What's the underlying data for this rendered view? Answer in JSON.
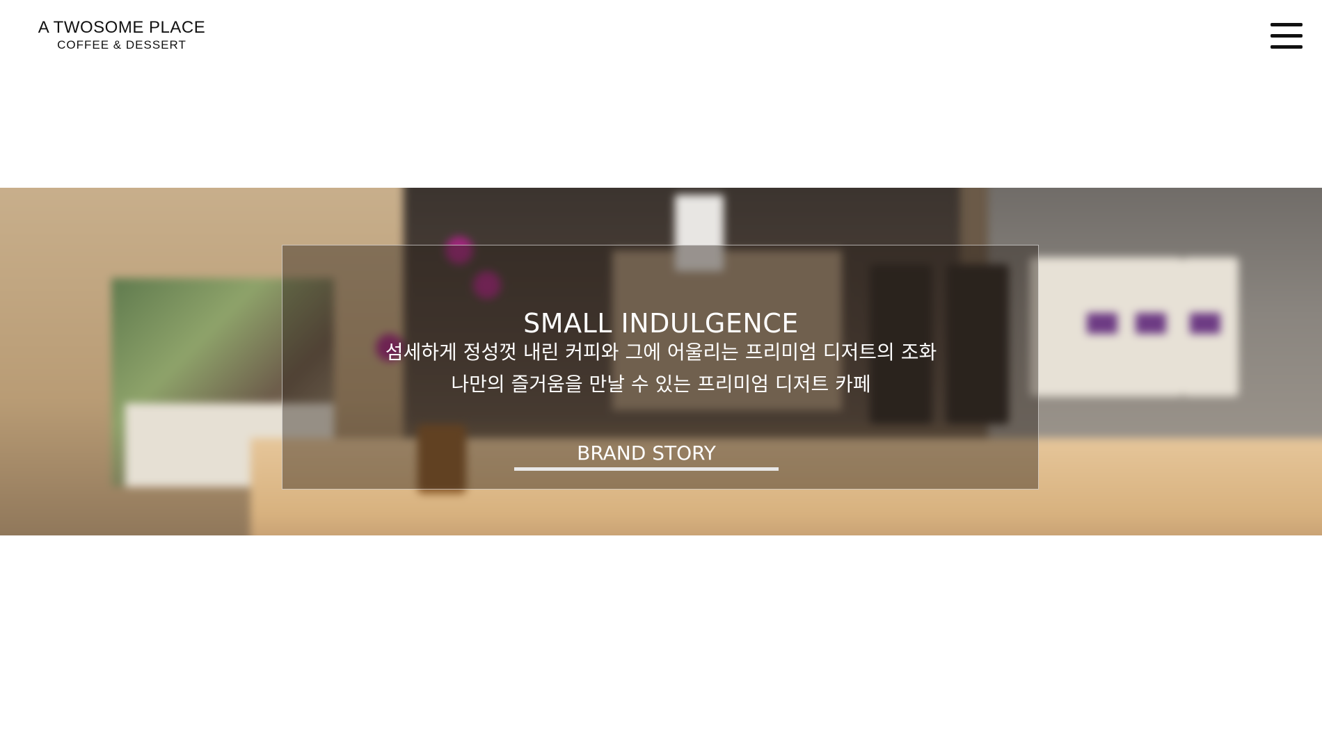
{
  "header": {
    "logo_title": "A TWOSOME PLACE",
    "logo_subtitle": "COFFEE & DESSERT",
    "menu_icon": "hamburger-menu-icon"
  },
  "hero": {
    "title": "SMALL INDULGENCE",
    "description_line1": "섬세하게 정성껏 내린 커피와 그에 어울리는 프리미엄 디저트의 조화",
    "description_line2": "나만의 즐거움을 만날 수 있는 프리미엄 디저트 카페",
    "cta_label": "BRAND STORY",
    "background_image": "blurred-cafe-counter-photo"
  },
  "colors": {
    "text_dark": "#111111",
    "text_light": "#ffffff",
    "panel_border": "#ffffff",
    "cta_underline": "#e8e8e8"
  }
}
